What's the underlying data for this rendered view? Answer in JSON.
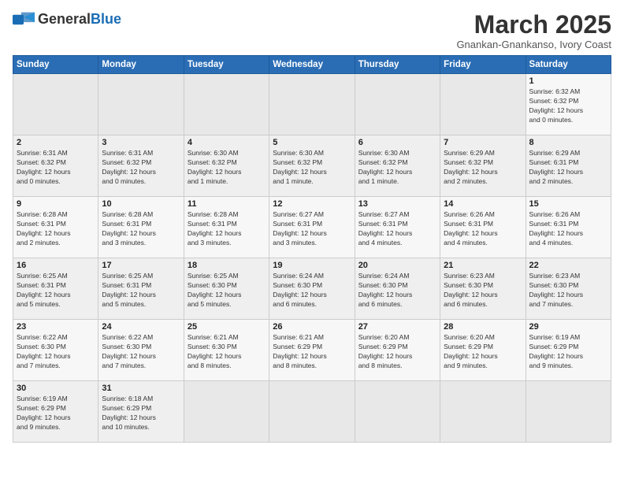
{
  "logo": {
    "text_general": "General",
    "text_blue": "Blue"
  },
  "header": {
    "month_title": "March 2025",
    "subtitle": "Gnankan-Gnankanso, Ivory Coast"
  },
  "days_of_week": [
    "Sunday",
    "Monday",
    "Tuesday",
    "Wednesday",
    "Thursday",
    "Friday",
    "Saturday"
  ],
  "weeks": [
    [
      {
        "day": "",
        "info": ""
      },
      {
        "day": "",
        "info": ""
      },
      {
        "day": "",
        "info": ""
      },
      {
        "day": "",
        "info": ""
      },
      {
        "day": "",
        "info": ""
      },
      {
        "day": "",
        "info": ""
      },
      {
        "day": "1",
        "info": "Sunrise: 6:32 AM\nSunset: 6:32 PM\nDaylight: 12 hours\nand 0 minutes."
      }
    ],
    [
      {
        "day": "2",
        "info": "Sunrise: 6:31 AM\nSunset: 6:32 PM\nDaylight: 12 hours\nand 0 minutes."
      },
      {
        "day": "3",
        "info": "Sunrise: 6:31 AM\nSunset: 6:32 PM\nDaylight: 12 hours\nand 0 minutes."
      },
      {
        "day": "4",
        "info": "Sunrise: 6:30 AM\nSunset: 6:32 PM\nDaylight: 12 hours\nand 1 minute."
      },
      {
        "day": "5",
        "info": "Sunrise: 6:30 AM\nSunset: 6:32 PM\nDaylight: 12 hours\nand 1 minute."
      },
      {
        "day": "6",
        "info": "Sunrise: 6:30 AM\nSunset: 6:32 PM\nDaylight: 12 hours\nand 1 minute."
      },
      {
        "day": "7",
        "info": "Sunrise: 6:29 AM\nSunset: 6:32 PM\nDaylight: 12 hours\nand 2 minutes."
      },
      {
        "day": "8",
        "info": "Sunrise: 6:29 AM\nSunset: 6:31 PM\nDaylight: 12 hours\nand 2 minutes."
      }
    ],
    [
      {
        "day": "9",
        "info": "Sunrise: 6:28 AM\nSunset: 6:31 PM\nDaylight: 12 hours\nand 2 minutes."
      },
      {
        "day": "10",
        "info": "Sunrise: 6:28 AM\nSunset: 6:31 PM\nDaylight: 12 hours\nand 3 minutes."
      },
      {
        "day": "11",
        "info": "Sunrise: 6:28 AM\nSunset: 6:31 PM\nDaylight: 12 hours\nand 3 minutes."
      },
      {
        "day": "12",
        "info": "Sunrise: 6:27 AM\nSunset: 6:31 PM\nDaylight: 12 hours\nand 3 minutes."
      },
      {
        "day": "13",
        "info": "Sunrise: 6:27 AM\nSunset: 6:31 PM\nDaylight: 12 hours\nand 4 minutes."
      },
      {
        "day": "14",
        "info": "Sunrise: 6:26 AM\nSunset: 6:31 PM\nDaylight: 12 hours\nand 4 minutes."
      },
      {
        "day": "15",
        "info": "Sunrise: 6:26 AM\nSunset: 6:31 PM\nDaylight: 12 hours\nand 4 minutes."
      }
    ],
    [
      {
        "day": "16",
        "info": "Sunrise: 6:25 AM\nSunset: 6:31 PM\nDaylight: 12 hours\nand 5 minutes."
      },
      {
        "day": "17",
        "info": "Sunrise: 6:25 AM\nSunset: 6:31 PM\nDaylight: 12 hours\nand 5 minutes."
      },
      {
        "day": "18",
        "info": "Sunrise: 6:25 AM\nSunset: 6:30 PM\nDaylight: 12 hours\nand 5 minutes."
      },
      {
        "day": "19",
        "info": "Sunrise: 6:24 AM\nSunset: 6:30 PM\nDaylight: 12 hours\nand 6 minutes."
      },
      {
        "day": "20",
        "info": "Sunrise: 6:24 AM\nSunset: 6:30 PM\nDaylight: 12 hours\nand 6 minutes."
      },
      {
        "day": "21",
        "info": "Sunrise: 6:23 AM\nSunset: 6:30 PM\nDaylight: 12 hours\nand 6 minutes."
      },
      {
        "day": "22",
        "info": "Sunrise: 6:23 AM\nSunset: 6:30 PM\nDaylight: 12 hours\nand 7 minutes."
      }
    ],
    [
      {
        "day": "23",
        "info": "Sunrise: 6:22 AM\nSunset: 6:30 PM\nDaylight: 12 hours\nand 7 minutes."
      },
      {
        "day": "24",
        "info": "Sunrise: 6:22 AM\nSunset: 6:30 PM\nDaylight: 12 hours\nand 7 minutes."
      },
      {
        "day": "25",
        "info": "Sunrise: 6:21 AM\nSunset: 6:30 PM\nDaylight: 12 hours\nand 8 minutes."
      },
      {
        "day": "26",
        "info": "Sunrise: 6:21 AM\nSunset: 6:29 PM\nDaylight: 12 hours\nand 8 minutes."
      },
      {
        "day": "27",
        "info": "Sunrise: 6:20 AM\nSunset: 6:29 PM\nDaylight: 12 hours\nand 8 minutes."
      },
      {
        "day": "28",
        "info": "Sunrise: 6:20 AM\nSunset: 6:29 PM\nDaylight: 12 hours\nand 9 minutes."
      },
      {
        "day": "29",
        "info": "Sunrise: 6:19 AM\nSunset: 6:29 PM\nDaylight: 12 hours\nand 9 minutes."
      }
    ],
    [
      {
        "day": "30",
        "info": "Sunrise: 6:19 AM\nSunset: 6:29 PM\nDaylight: 12 hours\nand 9 minutes."
      },
      {
        "day": "31",
        "info": "Sunrise: 6:18 AM\nSunset: 6:29 PM\nDaylight: 12 hours\nand 10 minutes."
      },
      {
        "day": "",
        "info": ""
      },
      {
        "day": "",
        "info": ""
      },
      {
        "day": "",
        "info": ""
      },
      {
        "day": "",
        "info": ""
      },
      {
        "day": "",
        "info": ""
      }
    ]
  ]
}
